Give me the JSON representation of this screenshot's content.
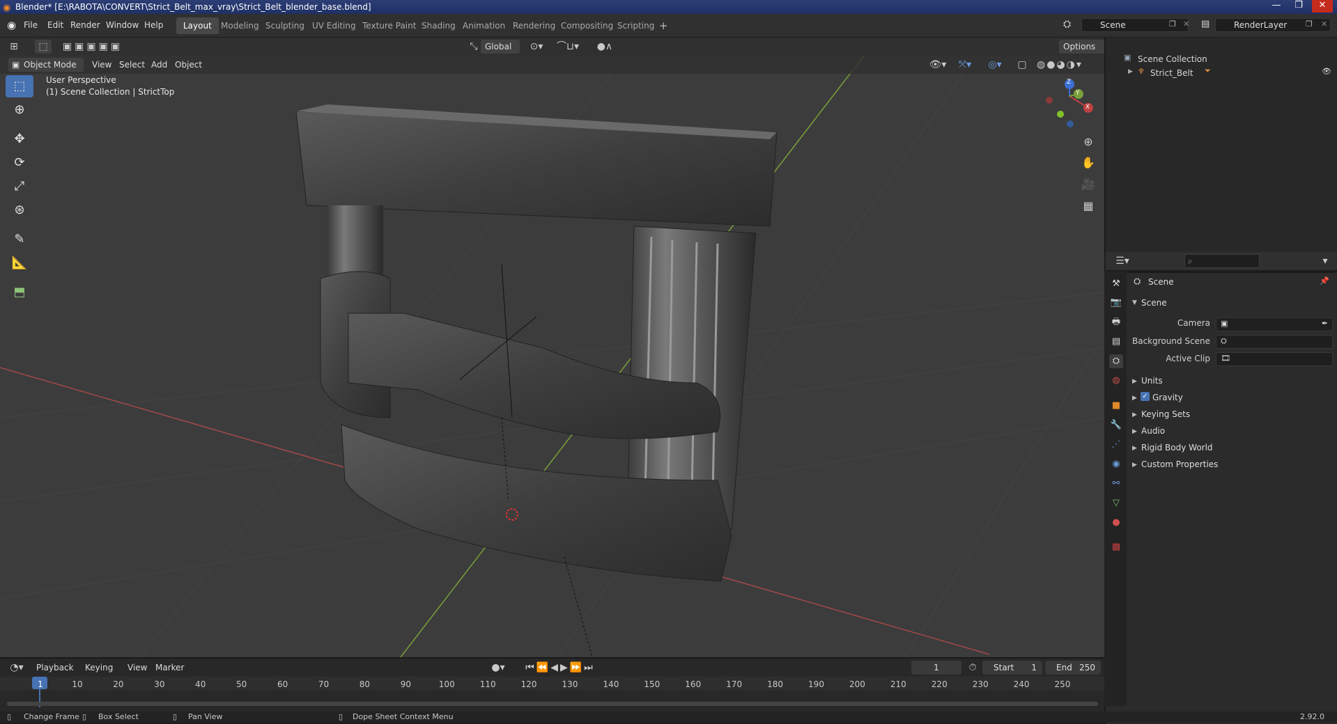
{
  "window": {
    "title": "Blender* [E:\\RABOTA\\CONVERT\\Strict_Belt_max_vray\\Strict_Belt_blender_base.blend]"
  },
  "menus": [
    "File",
    "Edit",
    "Render",
    "Window",
    "Help"
  ],
  "workspaces": [
    "Layout",
    "Modeling",
    "Sculpting",
    "UV Editing",
    "Texture Paint",
    "Shading",
    "Animation",
    "Rendering",
    "Compositing",
    "Scripting"
  ],
  "scene_field": "Scene",
  "render_layer_field": "RenderLayer",
  "header": {
    "transform_orientation": "Global",
    "options": "Options"
  },
  "viewport_header": {
    "mode": "Object Mode",
    "menus": [
      "View",
      "Select",
      "Add",
      "Object"
    ]
  },
  "viewport": {
    "perspective": "User Perspective",
    "collection_info": "(1) Scene Collection | StrictTop"
  },
  "gizmo_axes": {
    "x": "X",
    "y": "Y",
    "z": "Z"
  },
  "outliner": {
    "root": "Scene Collection",
    "items": [
      "Strict_Belt"
    ]
  },
  "properties": {
    "context": "Scene",
    "section": "Scene",
    "fields": [
      {
        "label": "Camera"
      },
      {
        "label": "Background Scene"
      },
      {
        "label": "Active Clip"
      }
    ],
    "subpanels": [
      "Units",
      "Gravity",
      "Keying Sets",
      "Audio",
      "Rigid Body World",
      "Custom Properties"
    ],
    "gravity_checked": true
  },
  "timeline": {
    "menus": [
      "Playback",
      "Keying",
      "View",
      "Marker"
    ],
    "current_frame": "1",
    "start_label": "Start",
    "start": "1",
    "end_label": "End",
    "end": "250",
    "ticks": [
      "1",
      "10",
      "20",
      "30",
      "40",
      "50",
      "60",
      "70",
      "80",
      "90",
      "100",
      "110",
      "120",
      "130",
      "140",
      "150",
      "160",
      "170",
      "180",
      "190",
      "200",
      "210",
      "220",
      "230",
      "240",
      "250"
    ]
  },
  "statusbar": {
    "items": [
      "Change Frame",
      "Box Select",
      "Pan View",
      "Dope Sheet Context Menu"
    ],
    "version": "2.92.0"
  },
  "colors": {
    "accent": "#4772b3",
    "axis_x": "#c04040",
    "axis_y": "#7aa03a",
    "axis_z": "#3b6fd4"
  }
}
